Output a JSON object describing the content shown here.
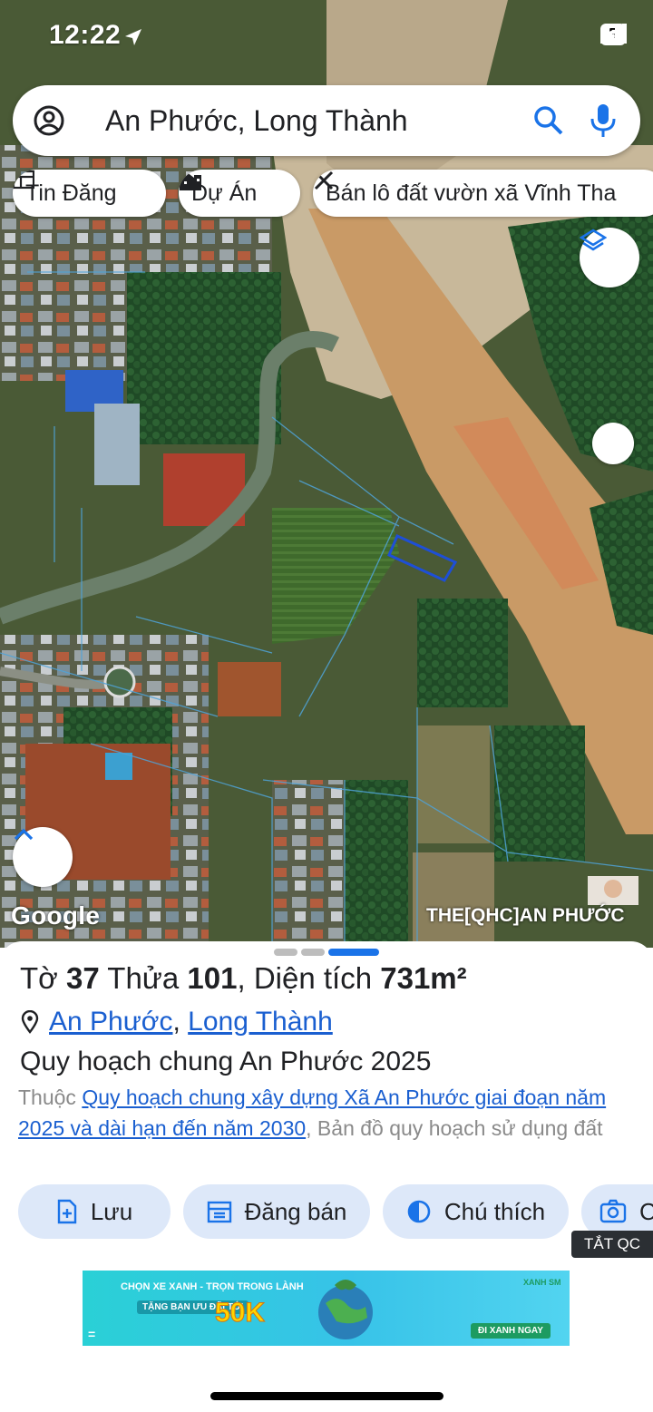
{
  "status_bar": {
    "time": "12:22",
    "battery": "5"
  },
  "search": {
    "query": "An Phước, Long Thành"
  },
  "chips": [
    {
      "label": "Tin Đăng",
      "icon": "listing-icon"
    },
    {
      "label": "Dự Án",
      "icon": "building-icon"
    },
    {
      "label": "Bán lô đất vườn xã Vĩnh Tha",
      "icon": "tools-icon"
    }
  ],
  "map": {
    "attribution": "Google",
    "layer_label": "THE[QHC]AN PHƯỚC",
    "colors": {
      "parcel_outline": "#4fa3d8",
      "selected_parcel": "#1e4fd6"
    }
  },
  "sheet": {
    "title_prefix": "Tờ",
    "sheet_no": "37",
    "parcel_label": "Thửa",
    "parcel_no": "101",
    "area_label": ", Diện tích",
    "area_value": "731m²",
    "location": {
      "ward": "An Phước",
      "separator": ",",
      "district": "Long Thành"
    },
    "plan_name": "Quy hoạch chung An Phước 2025",
    "desc": {
      "prefix": "Thuộc ",
      "link": "Quy hoạch chung xây dựng Xã An Phước giai đoạn năm 2025 và dài hạn đến năm 2030",
      "suffix": ", Bản đồ quy hoạch sử dụng đất"
    },
    "actions": [
      {
        "label": "Lưu",
        "icon": "save-file-icon"
      },
      {
        "label": "Đăng bán",
        "icon": "calendar-icon"
      },
      {
        "label": "Chú thích",
        "icon": "contrast-icon"
      },
      {
        "label": "C",
        "icon": "camera-icon"
      }
    ],
    "accent": "#1a73e8"
  },
  "ad": {
    "close_label": "TẮT QC",
    "headline": "CHỌN XE XANH - TRỌN TRONG LÀNH",
    "offer_label": "TẶNG BẠN ƯU ĐÃI TỚI",
    "offer_value": "50K",
    "cta": "ĐI XANH NGAY",
    "brand": "XANH SM"
  }
}
